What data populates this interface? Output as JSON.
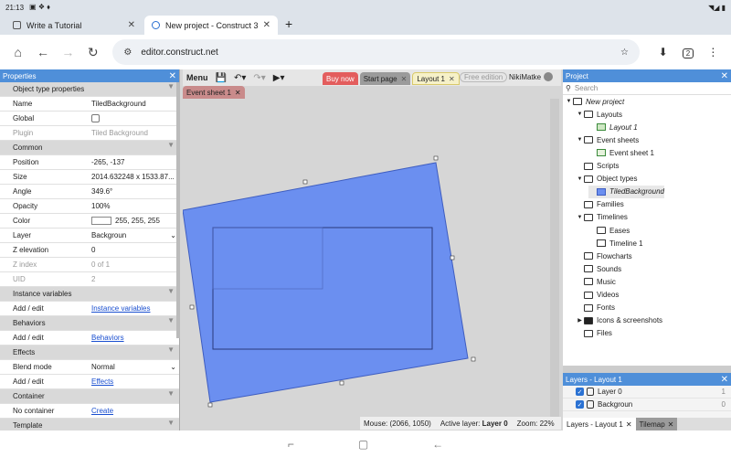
{
  "status": {
    "time": "21:13",
    "icons_left": "notification-icons",
    "icons_right": "wifi battery"
  },
  "tabs": [
    {
      "title": "Write a Tutorial"
    },
    {
      "title": "New project - Construct 3"
    }
  ],
  "address": {
    "url": "editor.construct.net",
    "tab_count": "2"
  },
  "properties": {
    "title": "Properties",
    "rows": [
      {
        "type": "header",
        "label": "Object type properties"
      },
      {
        "label": "Name",
        "value": "TiledBackground"
      },
      {
        "label": "Global",
        "value": "",
        "control": "checkbox"
      },
      {
        "label": "Plugin",
        "value": "Tiled Background",
        "dim": true
      },
      {
        "type": "header",
        "label": "Common"
      },
      {
        "label": "Position",
        "value": "-265, -137",
        "arrow": true
      },
      {
        "label": "Size",
        "value": "2014.632248 x 1533.87...",
        "arrow": true
      },
      {
        "label": "Angle",
        "value": "349.6°"
      },
      {
        "label": "Opacity",
        "value": "100%"
      },
      {
        "label": "Color",
        "value": "255, 255, 255",
        "control": "swatch"
      },
      {
        "label": "Layer",
        "value": "Backgroun",
        "control": "select"
      },
      {
        "label": "Z elevation",
        "value": "0"
      },
      {
        "label": "Z index",
        "value": "0 of 1",
        "dim": true
      },
      {
        "label": "UID",
        "value": "2",
        "dim": true
      },
      {
        "type": "header",
        "label": "Instance variables"
      },
      {
        "label": "Add / edit",
        "value": "Instance variables",
        "link": true
      },
      {
        "type": "header",
        "label": "Behaviors"
      },
      {
        "label": "Add / edit",
        "value": "Behaviors",
        "link": true
      },
      {
        "type": "header",
        "label": "Effects"
      },
      {
        "label": "Blend mode",
        "value": "Normal",
        "control": "select"
      },
      {
        "label": "Add / edit",
        "value": "Effects",
        "link": true
      },
      {
        "type": "header",
        "label": "Container"
      },
      {
        "label": "No container",
        "value": "Create",
        "link": true
      },
      {
        "type": "header",
        "label": "Template"
      }
    ]
  },
  "toolbar": {
    "menu": "Menu",
    "layout_tabs": [
      {
        "label": "Buy now"
      },
      {
        "label": "Start page"
      },
      {
        "label": "Layout 1"
      }
    ],
    "free_edition": "Free edition",
    "user": "NikiMatke",
    "event_tab": "Event sheet 1"
  },
  "status_bar": {
    "mouse": "Mouse: (2066, 1050)",
    "active_layer_label": "Active layer:",
    "active_layer": "Layer 0",
    "zoom": "Zoom: 22%"
  },
  "project": {
    "title": "Project",
    "search_placeholder": "Search",
    "tree": [
      {
        "label": "New project",
        "indent": 0,
        "twisty": "▼",
        "italic": true
      },
      {
        "label": "Layouts",
        "indent": 1,
        "twisty": "▼"
      },
      {
        "label": "Layout 1",
        "indent": 2,
        "icon": "layout",
        "italic": true
      },
      {
        "label": "Event sheets",
        "indent": 1,
        "twisty": "▼"
      },
      {
        "label": "Event sheet 1",
        "indent": 2,
        "icon": "sheet"
      },
      {
        "label": "Scripts",
        "indent": 1
      },
      {
        "label": "Object types",
        "indent": 1,
        "twisty": "▼"
      },
      {
        "label": "TiledBackground",
        "indent": 2,
        "icon": "tiled",
        "italic": true,
        "highlight": true
      },
      {
        "label": "Families",
        "indent": 1
      },
      {
        "label": "Timelines",
        "indent": 1,
        "twisty": "▼"
      },
      {
        "label": "Eases",
        "indent": 2
      },
      {
        "label": "Timeline 1",
        "indent": 2,
        "icon": "timeline"
      },
      {
        "label": "Flowcharts",
        "indent": 1
      },
      {
        "label": "Sounds",
        "indent": 1
      },
      {
        "label": "Music",
        "indent": 1
      },
      {
        "label": "Videos",
        "indent": 1
      },
      {
        "label": "Fonts",
        "indent": 1
      },
      {
        "label": "Icons & screenshots",
        "indent": 0,
        "twisty": "▶",
        "dark": true
      },
      {
        "label": "Files",
        "indent": 1
      }
    ]
  },
  "layers": {
    "title": "Layers - Layout 1",
    "items": [
      {
        "name": "Layer 0",
        "n": "1"
      },
      {
        "name": "Backgroun",
        "n": "0"
      }
    ],
    "tabs": [
      {
        "label": "Layers - Layout 1"
      },
      {
        "label": "Tilemap"
      }
    ]
  },
  "colors": {
    "accent": "#4f8fd9",
    "object_fill": "#6b8ff0"
  }
}
